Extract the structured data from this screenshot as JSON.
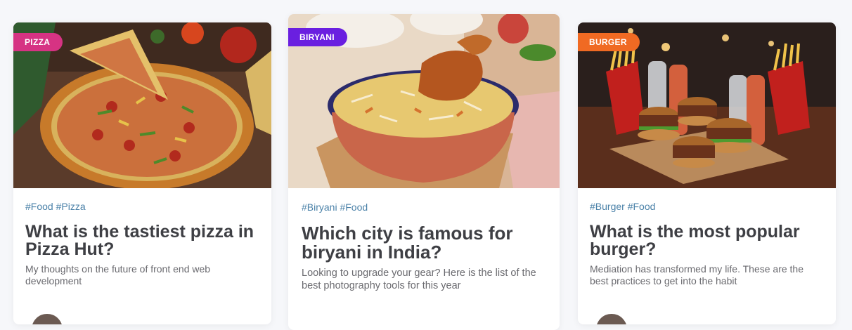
{
  "cards": [
    {
      "badge": "PIZZA",
      "badge_color": "#d63383",
      "tags": "#Food #Pizza",
      "title": "What is the tastiest pizza in Pizza Hut?",
      "description": "My thoughts on the future of front end web development",
      "image": "pizza-photo"
    },
    {
      "badge": "BIRYANI",
      "badge_color": "#6a1fe0",
      "tags": "#Biryani #Food",
      "title": "Which city is famous for biryani in India?",
      "description": "Looking to upgrade your gear? Here is the list of the best photography tools for this year",
      "image": "biryani-photo"
    },
    {
      "badge": "BURGER",
      "badge_color": "#f06a23",
      "tags": "#Burger #Food",
      "title": "What is the most popular burger?",
      "description": "Mediation has transformed my life. These are the best practices to get into the habit",
      "image": "burger-photo"
    }
  ],
  "colors": {
    "tag": "#4a81a8",
    "title": "#3e3f44",
    "description": "#6a6a6f",
    "background": "#f6f7fa"
  }
}
